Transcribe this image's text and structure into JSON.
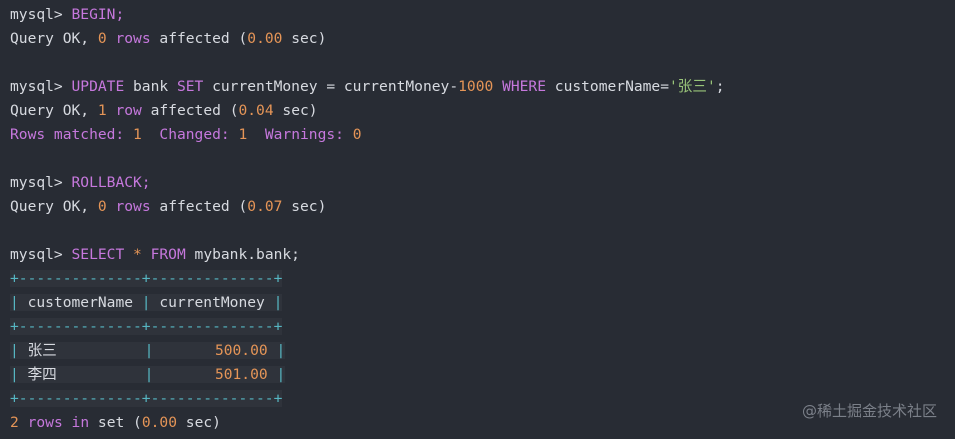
{
  "prompt": "mysql>",
  "cmd_begin": {
    "text": "BEGIN;"
  },
  "result_begin": {
    "prefix": "Query OK, ",
    "count": "0",
    "rows": "rows",
    "affected": " affected (",
    "time": "0.00",
    "suffix": " sec)"
  },
  "cmd_update": {
    "kw_update": "UPDATE",
    "table": " bank ",
    "kw_set": "SET",
    "col": " currentMoney = currentMoney-",
    "amount": "1000",
    "kw_where": " WHERE",
    "cond": " customerName=",
    "value": "'张三'",
    "end": ";"
  },
  "result_update": {
    "prefix": "Query OK, ",
    "count": "1",
    "rows": "row",
    "affected": " affected (",
    "time": "0.04",
    "suffix": " sec)"
  },
  "rows_matched": {
    "label_matched": "Rows matched:",
    "matched": "1",
    "label_changed": "Changed:",
    "changed": "1",
    "label_warnings": "Warnings:",
    "warnings": "0"
  },
  "cmd_rollback": {
    "text": "ROLLBACK;"
  },
  "result_rollback": {
    "prefix": "Query OK, ",
    "count": "0",
    "rows": "rows",
    "affected": " affected (",
    "time": "0.07",
    "suffix": " sec)"
  },
  "cmd_select": {
    "kw_select": "SELECT",
    "star": " * ",
    "kw_from": "FROM",
    "target": " mybank.bank;"
  },
  "table": {
    "border": "+--------------+--------------+",
    "headers": [
      "customerName",
      "currentMoney"
    ],
    "rows": [
      {
        "name": "张三",
        "money": "500.00"
      },
      {
        "name": "李四",
        "money": "501.00"
      }
    ]
  },
  "result_select": {
    "count": "2",
    "rows": "rows",
    "in": "in",
    "set": " set (",
    "time": "0.00",
    "suffix": " sec)"
  },
  "watermark": "@稀土掘金技术社区"
}
